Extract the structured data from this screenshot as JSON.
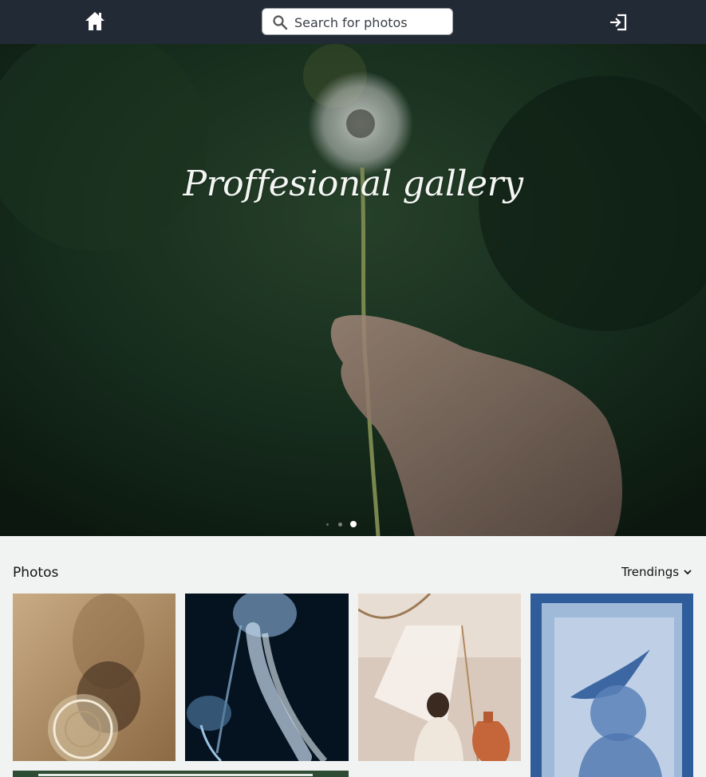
{
  "navbar": {
    "home_icon": "home-icon",
    "search": {
      "placeholder": "Search for photos",
      "icon": "search-icon"
    },
    "login_icon": "login-icon",
    "background": "#222a36"
  },
  "hero": {
    "title": "Proffesional gallery",
    "carousel": {
      "total_slides": 3,
      "active_slide": 3
    }
  },
  "gallery": {
    "title": "Photos",
    "sort": {
      "label": "Trendings",
      "icon": "chevron-down-icon"
    },
    "photos": [
      {
        "subject": "glass-shadow"
      },
      {
        "subject": "jellyfish"
      },
      {
        "subject": "woman-with-vase"
      },
      {
        "subject": "cyanotype-bird"
      },
      {
        "subject": "green-landscape"
      }
    ]
  }
}
